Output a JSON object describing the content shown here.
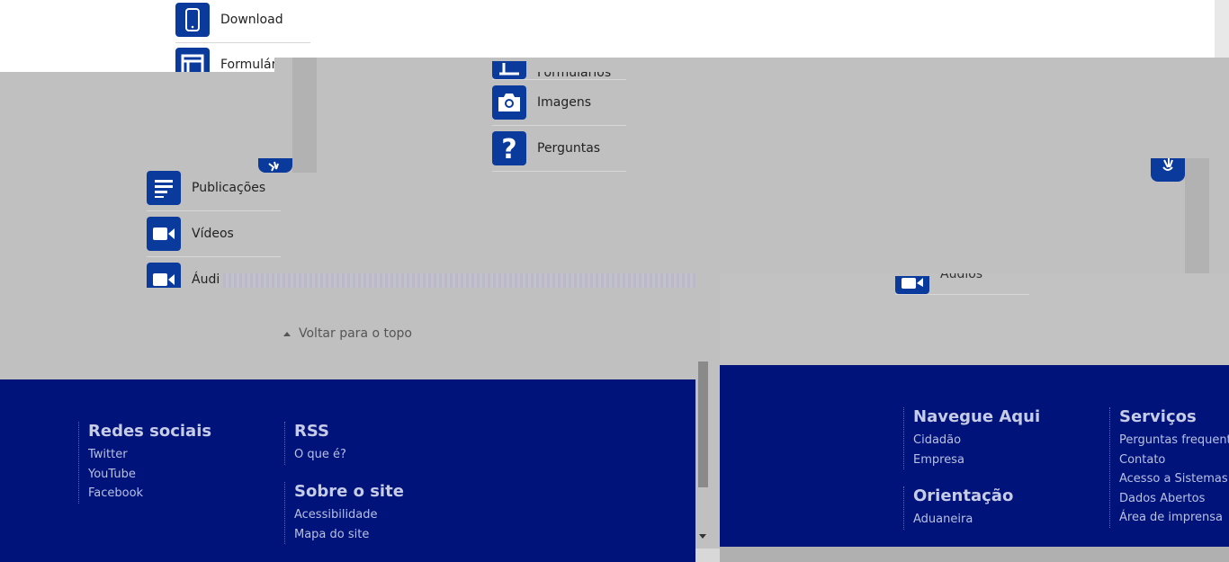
{
  "menu": {
    "download": "Download",
    "formularios_clipped": "Formulár",
    "formularios": "Formulários",
    "imagens": "Imagens",
    "perguntas": "Perguntas",
    "publicacoes": "Publicações",
    "videos": "Vídeos",
    "audios_clipped": "Áudi",
    "audios": "Áudios"
  },
  "back_to_top": "Voltar para o topo",
  "footer": {
    "redes_sociais": {
      "title": "Redes sociais",
      "links": [
        "Twitter",
        "YouTube",
        "Facebook"
      ]
    },
    "rss": {
      "title": "RSS",
      "links": [
        "O que é?"
      ]
    },
    "sobre": {
      "title": "Sobre o site",
      "links": [
        "Acessibilidade",
        "Mapa do site"
      ]
    },
    "navegue": {
      "title": "Navegue Aqui",
      "links": [
        "Cidadão",
        "Empresa"
      ]
    },
    "orientacao": {
      "title": "Orientação",
      "links": [
        "Aduaneira"
      ]
    },
    "servicos": {
      "title": "Serviços",
      "links": [
        "Perguntas frequentes",
        "Contato",
        "Acesso a Sistemas",
        "Dados Abertos",
        "Área de imprensa"
      ]
    }
  },
  "colors": {
    "footer_bg": "#00137a",
    "icon_bg": "#0a3a9c",
    "overlay_gray": "#c0c0c0"
  },
  "icons": [
    "tablet-icon",
    "form-icon",
    "camera-icon",
    "question-icon",
    "document-icon",
    "video-icon",
    "audio-icon",
    "accessibility-badge-icon",
    "chevron-up-icon",
    "scroll-down-icon"
  ]
}
